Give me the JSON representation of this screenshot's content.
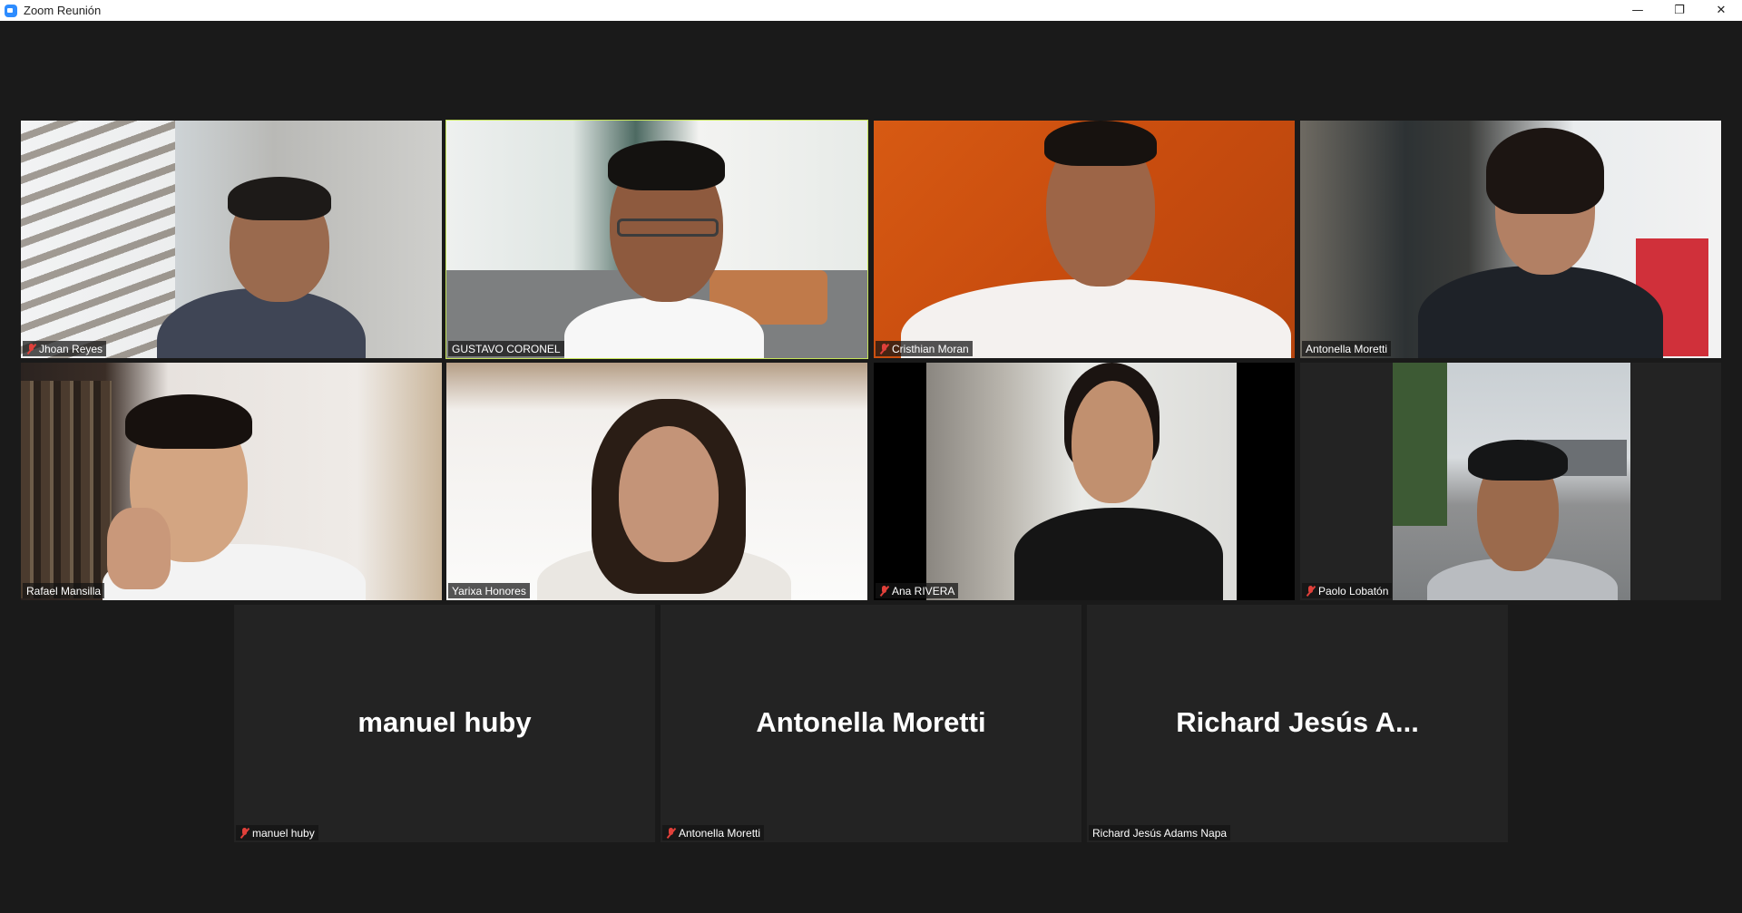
{
  "window": {
    "title": "Zoom Reunión",
    "minimize": "—",
    "restore": "❐",
    "close": "✕"
  },
  "participants": [
    {
      "name": "Jhoan Reyes",
      "muted": true,
      "video": true
    },
    {
      "name": "GUSTAVO CORONEL",
      "muted": false,
      "video": true,
      "active_speaker": true
    },
    {
      "name": "Cristhian Moran",
      "muted": true,
      "video": true
    },
    {
      "name": "Antonella Moretti",
      "muted": false,
      "video": true
    },
    {
      "name": "Rafael Mansilla",
      "muted": false,
      "video": true
    },
    {
      "name": "Yarixa Honores",
      "muted": false,
      "video": true
    },
    {
      "name": "Ana RIVERA",
      "muted": true,
      "video": true
    },
    {
      "name": "Paolo Lobatón",
      "muted": true,
      "video": true
    },
    {
      "name": "manuel huby",
      "display_name": "manuel huby",
      "muted": true,
      "video": false
    },
    {
      "name": "Antonella Moretti",
      "display_name": "Antonella Moretti",
      "muted": true,
      "video": false
    },
    {
      "name": "Richard Jesús Adams Napa",
      "display_name": "Richard  Jesús  A...",
      "muted": false,
      "video": false
    }
  ],
  "colors": {
    "active_speaker_border": "#c6e45a",
    "mute_red": "#e0403a",
    "background": "#1a1a1a"
  }
}
